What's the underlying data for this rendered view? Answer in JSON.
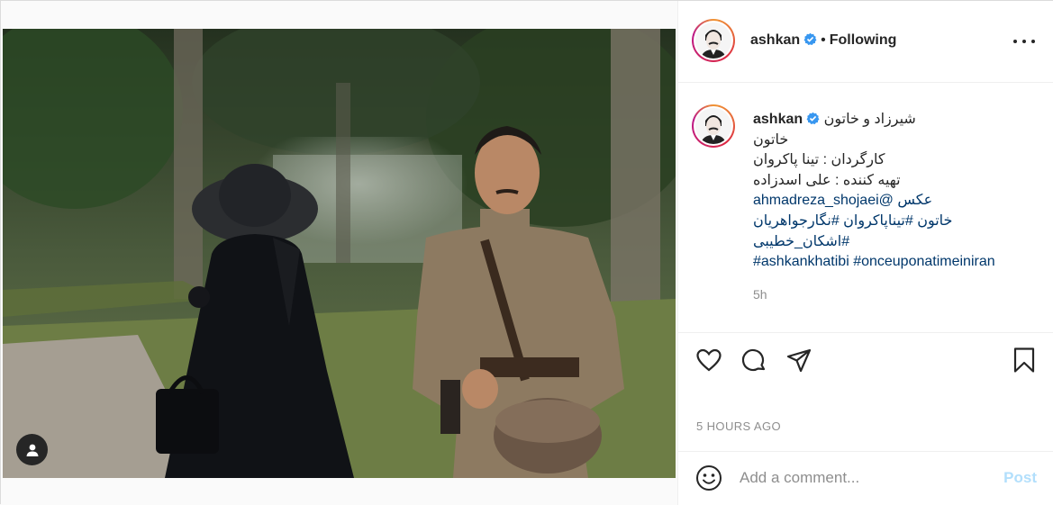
{
  "post": {
    "author": "ashkan",
    "follow_status": "Following",
    "caption_lines": [
      "شیرزاد و خاتون",
      "خاتون",
      "کارگردان : تینا پاکروان",
      "تهیه کننده : علی اسدزاده",
      "عکس @ahmadreza_shojaei",
      "خاتون #تیناپاکروان #نگارجواهریان",
      "#اشکان_خطیبی",
      "#ashkankhatibi #onceuponatimeiniran"
    ],
    "caption_age": "5h",
    "timestamp": "5 HOURS AGO"
  },
  "icons": {
    "user_tag": "person-icon",
    "verified": "verified-badge-icon",
    "like": "heart-icon",
    "comment": "comment-bubble-icon",
    "share": "paper-plane-icon",
    "save": "bookmark-icon",
    "emoji": "smiley-icon",
    "more": "more-dots-icon"
  },
  "comment_box": {
    "placeholder": "Add a comment...",
    "post_label": "Post"
  },
  "colors": {
    "verified": "#3897f0",
    "post_button_disabled": "#b2dffc",
    "link": "#00376b"
  }
}
